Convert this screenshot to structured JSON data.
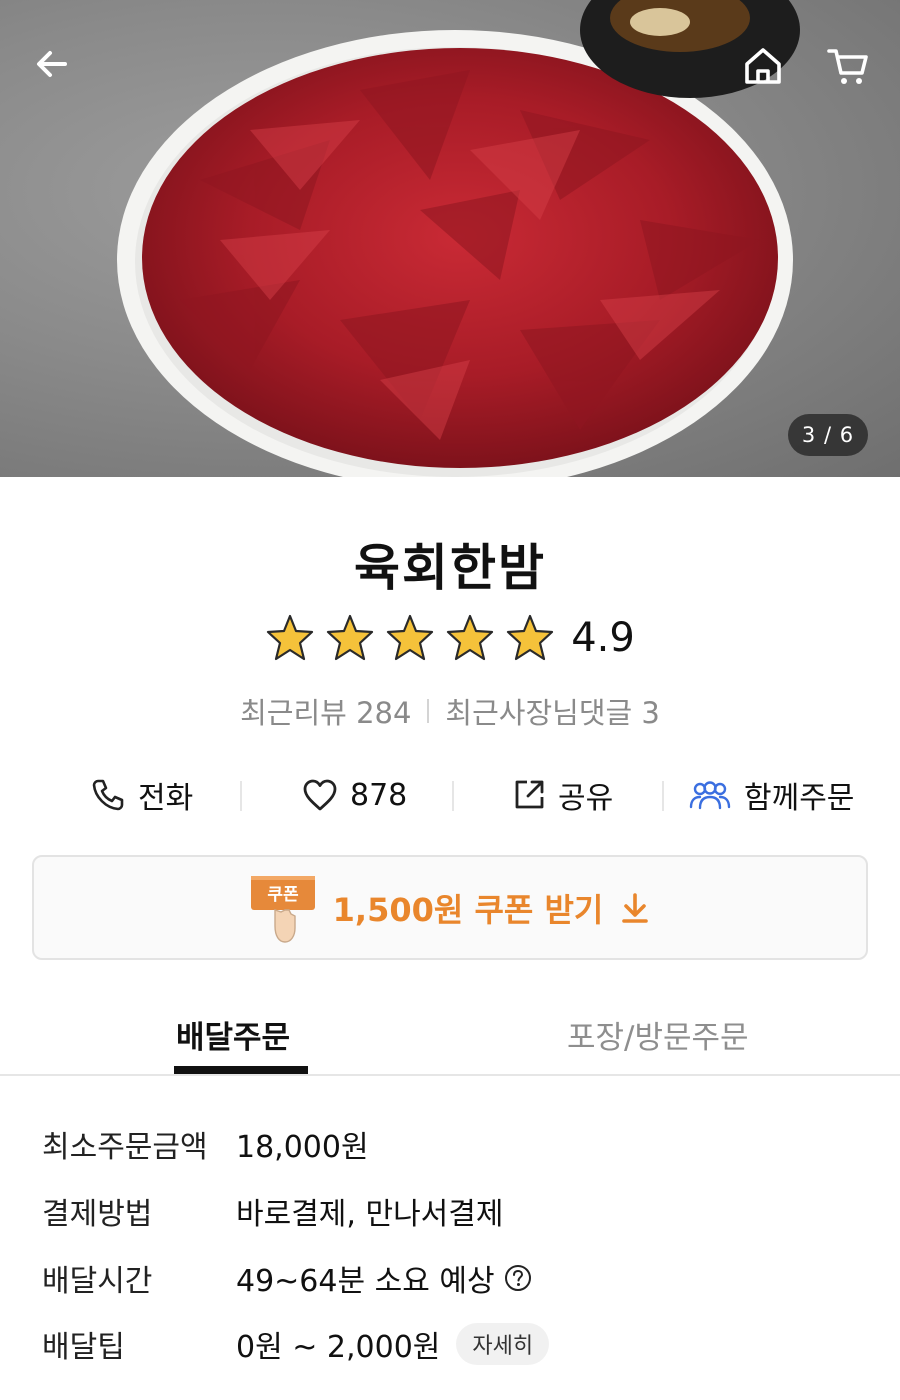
{
  "hero": {
    "pager": "3 / 6",
    "icons": {
      "back": "back-arrow-icon",
      "home": "home-icon",
      "cart": "cart-icon"
    }
  },
  "store": {
    "name": "육회한밤",
    "rating": "4.9",
    "stars": 5,
    "recent_reviews": "최근리뷰 284",
    "owner_comments": "최근사장님댓글 3"
  },
  "actions": {
    "call": "전화",
    "like_count": "878",
    "share": "공유",
    "group_order": "함께주문"
  },
  "coupon": {
    "badge": "쿠폰",
    "label": "1,500원 쿠폰 받기"
  },
  "tabs": {
    "delivery": "배달주문",
    "pickup": "포장/방문주문"
  },
  "info": {
    "min_order_label": "최소주문금액",
    "min_order_value": "18,000원",
    "payment_label": "결제방법",
    "payment_value": "바로결제, 만나서결제",
    "delivery_time_label": "배달시간",
    "delivery_time_value": "49~64분 소요 예상",
    "delivery_tip_label": "배달팁",
    "delivery_tip_value": "0원 ~ 2,000원",
    "detail_button": "자세히"
  },
  "colors": {
    "accent_orange": "#e9862c",
    "group_icon_blue": "#3b6fe0",
    "star_gold": "#f5c23a"
  }
}
